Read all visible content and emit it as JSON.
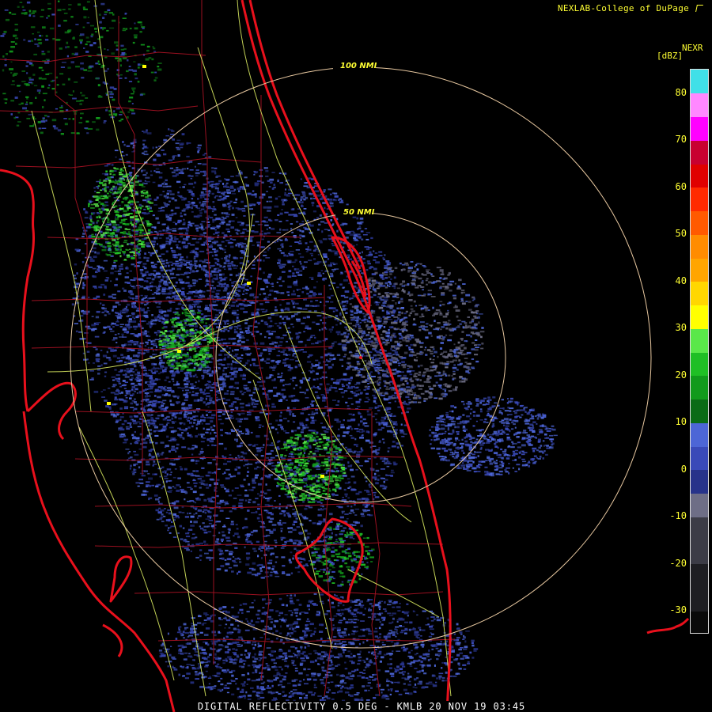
{
  "header": {
    "credit": "NEXLAB-College of DuPage"
  },
  "legend": {
    "product": "NEXR",
    "units": "[dBZ]",
    "ticks": [
      "80",
      "70",
      "60",
      "50",
      "40",
      "30",
      "20",
      "10",
      "0",
      "-10",
      "-20",
      "-30"
    ],
    "range_min": -35,
    "range_max": 85,
    "color_scale": [
      {
        "from": -35,
        "to": -30,
        "color": "#0a0a0a"
      },
      {
        "from": -30,
        "to": -20,
        "color": "#1e1e22"
      },
      {
        "from": -20,
        "to": -10,
        "color": "#3c3c46"
      },
      {
        "from": -10,
        "to": -5,
        "color": "#6e6e86"
      },
      {
        "from": -5,
        "to": 0,
        "color": "#27338a"
      },
      {
        "from": 0,
        "to": 5,
        "color": "#3a4ab8"
      },
      {
        "from": 5,
        "to": 10,
        "color": "#4d66d6"
      },
      {
        "from": 10,
        "to": 15,
        "color": "#0b6b16"
      },
      {
        "from": 15,
        "to": 20,
        "color": "#119a1c"
      },
      {
        "from": 20,
        "to": 25,
        "color": "#1fbf25"
      },
      {
        "from": 25,
        "to": 30,
        "color": "#5ae84a"
      },
      {
        "from": 30,
        "to": 35,
        "color": "#ffff00"
      },
      {
        "from": 35,
        "to": 40,
        "color": "#ffd700"
      },
      {
        "from": 40,
        "to": 45,
        "color": "#ffa500"
      },
      {
        "from": 45,
        "to": 50,
        "color": "#ff8c00"
      },
      {
        "from": 50,
        "to": 55,
        "color": "#ff5a00"
      },
      {
        "from": 55,
        "to": 60,
        "color": "#ff2a00"
      },
      {
        "from": 60,
        "to": 65,
        "color": "#e00000"
      },
      {
        "from": 65,
        "to": 70,
        "color": "#c80030"
      },
      {
        "from": 70,
        "to": 75,
        "color": "#ff00ff"
      },
      {
        "from": 75,
        "to": 80,
        "color": "#ff88ff"
      },
      {
        "from": 80,
        "to": 85,
        "color": "#40e0e8"
      }
    ]
  },
  "range_rings": [
    {
      "label": "50 NMI"
    },
    {
      "label": "100 NMI"
    }
  ],
  "footer": {
    "caption": "DIGITAL REFLECTIVITY 0.5 DEG - KMLB 20 NOV 19 03:45"
  },
  "colors": {
    "coastline": "#e8101c",
    "county_lines": "#9a1020",
    "roads": "#d8e860",
    "rings": "#e8c8a0",
    "label_text": "#ffff33"
  },
  "icons": [
    "nexlab-logo-icon"
  ]
}
